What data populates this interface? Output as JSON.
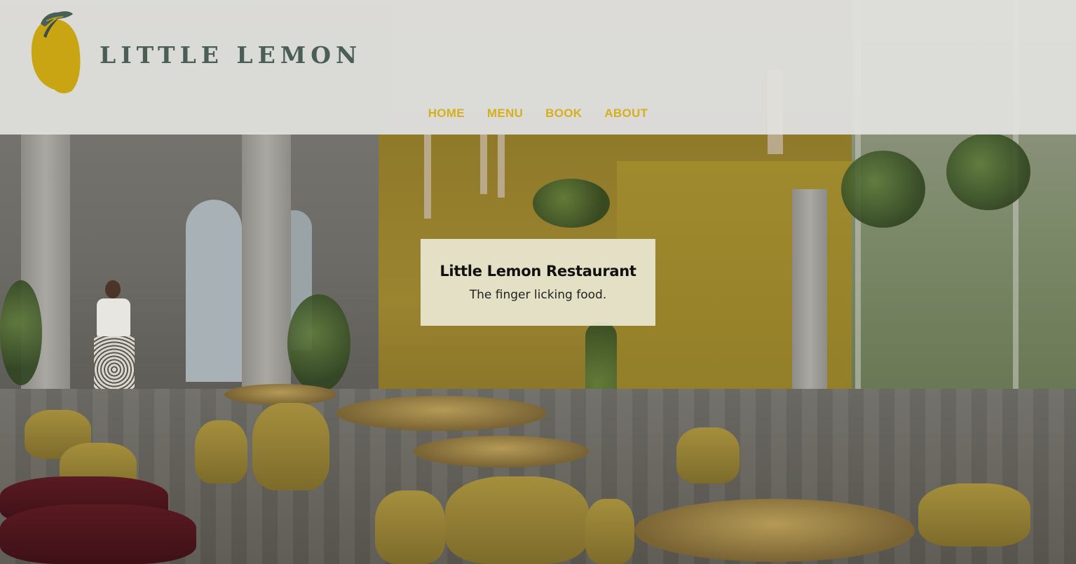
{
  "brand": {
    "name": "LITTLE LEMON",
    "logo_icon": "lemon-icon",
    "text_color": "#495e57",
    "lemon_color": "#c9a514",
    "leaf_color": "#495e57"
  },
  "nav": {
    "color": "#d4b01e",
    "items": [
      {
        "label": "HOME"
      },
      {
        "label": "MENU"
      },
      {
        "label": "BOOK"
      },
      {
        "label": "ABOUT"
      }
    ]
  },
  "hero": {
    "title": "Little Lemon Restaurant",
    "subtitle": "The finger licking food.",
    "background_image": "restaurant-interior-photo"
  }
}
